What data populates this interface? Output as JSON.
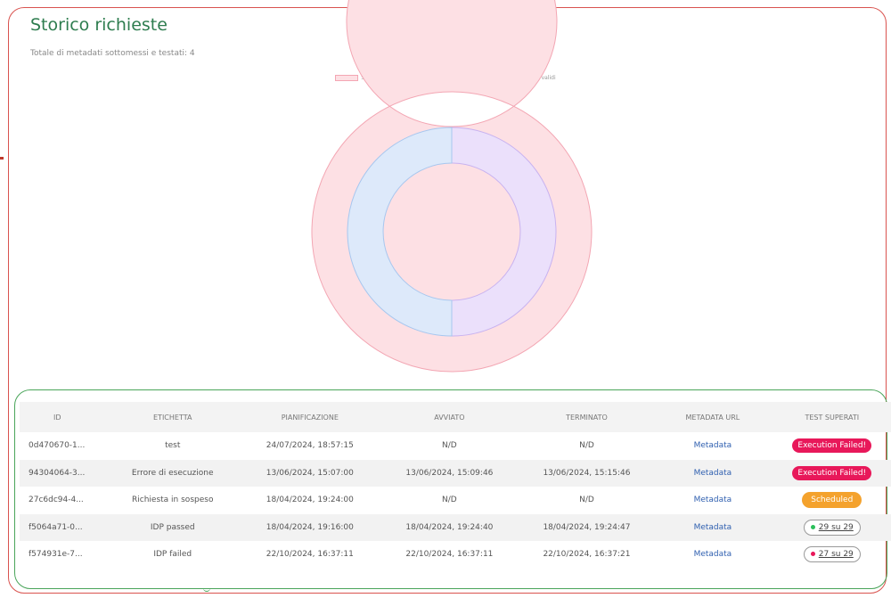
{
  "page": {
    "title": "Storico richieste",
    "subtitle": "Totale di metadati sottomessi e testati: 4"
  },
  "colors": {
    "accent": "#2e7d4f",
    "failed_badge": "#e8185a",
    "scheduled_badge": "#f4a22d",
    "passed_dot": "#2bbf5a",
    "failed_dot": "#e8185a"
  },
  "chart_data": {
    "type": "doughnut",
    "legend_position": "top",
    "legend": [
      {
        "name": "SP falliti",
        "fill": "#fde0e4",
        "stroke": "#f3a6b3"
      },
      {
        "name": "SP validi",
        "fill": "#dbf2f0",
        "stroke": "#9fd9d4"
      },
      {
        "name": "IDP falliti",
        "fill": "#ebe0fb",
        "stroke": "#c8b2f0"
      },
      {
        "name": "IDP validi",
        "fill": "#dde9fa",
        "stroke": "#a7c7ef"
      }
    ],
    "rings": [
      {
        "ring": "outer",
        "values": [
          {
            "name": "SP falliti",
            "value": 2
          },
          {
            "name": "SP validi",
            "value": 0
          }
        ]
      },
      {
        "ring": "inner",
        "values": [
          {
            "name": "IDP falliti",
            "value": 1
          },
          {
            "name": "IDP validi",
            "value": 1
          }
        ]
      }
    ]
  },
  "table": {
    "headers": [
      "ID",
      "ETICHETTA",
      "PIANIFICAZIONE",
      "AVVIATO",
      "TERMINATO",
      "METADATA URL",
      "TEST SUPERATI"
    ],
    "rows": [
      {
        "id": "0d470670-1...",
        "label": "test",
        "scheduled": "24/07/2024, 18:57:15",
        "started": "N/D",
        "finished": "N/D",
        "url": "Metadata",
        "status": "Execution Failed!",
        "status_type": "failed"
      },
      {
        "id": "94304064-3...",
        "label": "Errore di esecuzione",
        "scheduled": "13/06/2024, 15:07:00",
        "started": "13/06/2024, 15:09:46",
        "finished": "13/06/2024, 15:15:46",
        "url": "Metadata",
        "status": "Execution Failed!",
        "status_type": "failed"
      },
      {
        "id": "27c6dc94-4...",
        "label": "Richiesta in sospeso",
        "scheduled": "18/04/2024, 19:24:00",
        "started": "N/D",
        "finished": "N/D",
        "url": "Metadata",
        "status": "Scheduled",
        "status_type": "scheduled"
      },
      {
        "id": "f5064a71-0...",
        "label": "IDP passed",
        "scheduled": "18/04/2024, 19:16:00",
        "started": "18/04/2024, 19:24:40",
        "finished": "18/04/2024, 19:24:47",
        "url": "Metadata",
        "status": "29 su 29",
        "status_type": "passed"
      },
      {
        "id": "f574931e-7...",
        "label": "IDP failed",
        "scheduled": "22/10/2024, 16:37:11",
        "started": "22/10/2024, 16:37:11",
        "finished": "22/10/2024, 16:37:21",
        "url": "Metadata",
        "status": "27 su 29",
        "status_type": "partial"
      }
    ]
  }
}
